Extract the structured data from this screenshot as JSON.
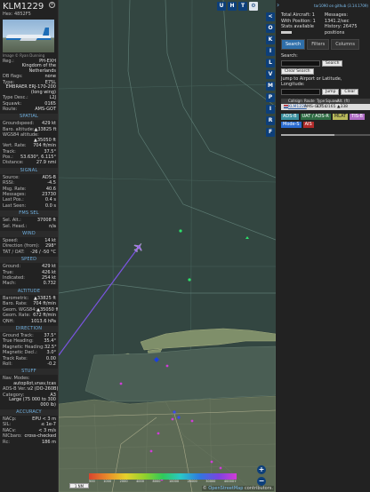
{
  "aircraft": {
    "callsign": "KLM1229",
    "hex": "Hex: 4852F5",
    "photo_credit": "Image © Ryan Dunning",
    "info": [
      {
        "k": "Reg.:",
        "v": "PH-EXH",
        "link": true
      },
      {
        "k": "",
        "v": "Kingdom of the Netherlands"
      },
      {
        "k": "DB flags:",
        "v": "none"
      },
      {
        "k": "Type:",
        "v": "E75L"
      },
      {
        "k": "",
        "v": "EMBRAER ERJ-170-200 (long wing)"
      },
      {
        "k": "Type Desc.:",
        "v": "L2J"
      },
      {
        "k": "Squawk:",
        "v": "0165"
      },
      {
        "k": "Route:",
        "v": "AMS-GOT"
      }
    ]
  },
  "sections": [
    {
      "title": "SPATIAL",
      "rows": [
        {
          "k": "Groundspeed:",
          "v": "429 kt"
        },
        {
          "k": "Baro. altitude:",
          "v": "▲33825 ft"
        },
        {
          "k": "WGS84 altitude:",
          "v": ""
        },
        {
          "k": "",
          "v": "▲35050 ft"
        },
        {
          "k": "Vert. Rate:",
          "v": "704 ft/min"
        },
        {
          "k": "Track:",
          "v": "37.5°"
        },
        {
          "k": "Pos.:",
          "v": "53.630°, 6.115°"
        },
        {
          "k": "Distance:",
          "v": "27.9 nmi"
        }
      ]
    },
    {
      "title": "SIGNAL",
      "rows": [
        {
          "k": "Source:",
          "v": "ADS-B"
        },
        {
          "k": "RSSI:",
          "v": "-4.5"
        },
        {
          "k": "Msg. Rate:",
          "v": "40.6"
        },
        {
          "k": "Messages:",
          "v": "23730"
        },
        {
          "k": "Last Pos.:",
          "v": "0.4 s"
        },
        {
          "k": "Last Seen:",
          "v": "0.0 s"
        }
      ]
    },
    {
      "title": "FMS SEL",
      "rows": [
        {
          "k": "Sel. Alt.:",
          "v": "37008 ft"
        },
        {
          "k": "Sel. Head.:",
          "v": "n/a"
        }
      ]
    },
    {
      "title": "WIND",
      "rows": [
        {
          "k": "Speed:",
          "v": "14 kt"
        },
        {
          "k": "Direction (from):",
          "v": "298°"
        },
        {
          "k": "TAT / OAT:",
          "v": "-26 / -50 °C"
        }
      ]
    },
    {
      "title": "SPEED",
      "rows": [
        {
          "k": "Ground:",
          "v": "429 kt"
        },
        {
          "k": "True:",
          "v": "426 kt"
        },
        {
          "k": "Indicated:",
          "v": "254 kt"
        },
        {
          "k": "Mach:",
          "v": "0.732"
        }
      ]
    },
    {
      "title": "ALTITUDE",
      "rows": [
        {
          "k": "Barometric:",
          "v": "▲33825 ft"
        },
        {
          "k": "Baro. Rate:",
          "v": "704 ft/min"
        },
        {
          "k": "Geom. WGS84:",
          "v": "▲35050 ft"
        },
        {
          "k": "Geom. Rate:",
          "v": "672 ft/min"
        },
        {
          "k": "QNH:",
          "v": "1013.6 hPa"
        }
      ]
    },
    {
      "title": "DIRECTION",
      "rows": [
        {
          "k": "Ground Track:",
          "v": "37.5°"
        },
        {
          "k": "True Heading:",
          "v": "35.4°"
        },
        {
          "k": "Magnetic Heading:",
          "v": "32.5°"
        },
        {
          "k": "Magnetic Decl.:",
          "v": "3.0°"
        },
        {
          "k": "Track Rate:",
          "v": "0.00"
        },
        {
          "k": "Roll:",
          "v": "-0.2"
        }
      ]
    },
    {
      "title": "STUFF",
      "rows": [
        {
          "k": "Nav. Modes:",
          "v": ""
        },
        {
          "k": "",
          "v": "autopilot,vnav,tcas"
        },
        {
          "k": "ADS-B Ver.:",
          "v": "v2 (DO-260B)"
        },
        {
          "k": "Category:",
          "v": "A3"
        },
        {
          "k": "",
          "v": "Large (75 000 to 300 000 lb)"
        }
      ]
    },
    {
      "title": "ACCURACY",
      "rows": [
        {
          "k": "NACp:",
          "v": "EPU < 3 m"
        },
        {
          "k": "SIL:",
          "v": "≤ 1e-7"
        },
        {
          "k": "NACv:",
          "v": "< 3 m/s"
        },
        {
          "k": "NICbaro:",
          "v": "cross-checked"
        },
        {
          "k": "Rc:",
          "v": "186 m"
        }
      ]
    }
  ],
  "map": {
    "top_buttons": [
      "U",
      "H",
      "T"
    ],
    "side_buttons": [
      "<",
      "O",
      "K",
      "I",
      "L",
      "V",
      "M",
      "P",
      "I",
      "R",
      "F"
    ],
    "zoom_in": "+",
    "zoom_out": "−",
    "scale_label": "1 NM",
    "altitude_labels": [
      "500",
      "1000",
      "2000",
      "4000",
      "8000",
      "10000",
      "20000",
      "30000",
      "40000+"
    ],
    "attribution_prefix": "© ",
    "attribution_link": "OpenStreetMap",
    "attribution_suffix": " contributors."
  },
  "right_panel": {
    "arrow": "›",
    "github_link": "tar1090 on github (3.14.1709)",
    "total_aircraft": "Total Aircraft: 1",
    "with_position": "With Position: 1",
    "stats_available": "Stats available",
    "messages": "Messages: 1341.2/sec",
    "history": "History: 26475 positions",
    "tabs": [
      "Search",
      "Filters",
      "Columns"
    ],
    "search_label": "Search:",
    "search_button": "Search",
    "clear_search": "Clear Search",
    "jump_label": "Jump to Airport or Latitude, Longitude:",
    "jump_button": "Jump",
    "clear_button": "Clear",
    "columns": [
      "",
      "Callsign",
      "Route",
      "Type",
      "Squawk",
      "Alt. (ft)"
    ],
    "rows": [
      {
        "callsign": "KLM1229",
        "route": "AMS-GOT",
        "type": "E75L",
        "squawk": "0165",
        "alt": "▲338"
      }
    ],
    "legend": [
      "ADS-B",
      "UAT / ADS-R",
      "MLAT",
      "TIS-B",
      "Mode-S",
      "AIS"
    ]
  }
}
